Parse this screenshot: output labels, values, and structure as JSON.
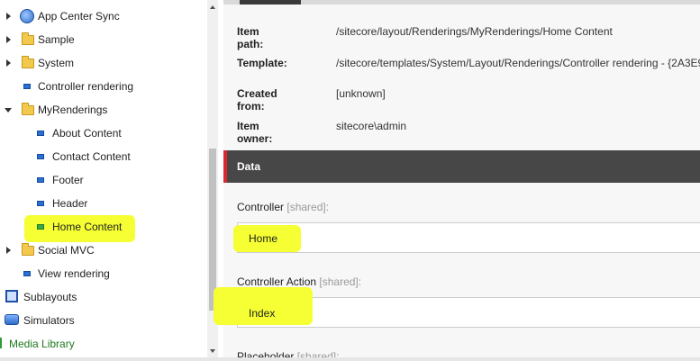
{
  "tree": {
    "items": [
      {
        "label": "App Center Sync"
      },
      {
        "label": "Sample"
      },
      {
        "label": "System"
      },
      {
        "label": "Controller rendering"
      },
      {
        "label": "MyRenderings"
      },
      {
        "label": "About Content"
      },
      {
        "label": "Contact Content"
      },
      {
        "label": "Footer"
      },
      {
        "label": "Header"
      },
      {
        "label": "Home Content"
      },
      {
        "label": "Social MVC"
      },
      {
        "label": "View rendering"
      },
      {
        "label": "Sublayouts"
      },
      {
        "label": "Simulators"
      },
      {
        "label": "Media Library"
      }
    ]
  },
  "info": {
    "item_path_label": "Item path:",
    "item_path": "/sitecore/layout/Renderings/MyRenderings/Home Content",
    "template_label": "Template:",
    "template": "/sitecore/templates/System/Layout/Renderings/Controller rendering - {2A3E9",
    "created_from_label": "Created from:",
    "created_from": "[unknown]",
    "item_owner_label": "Item owner:",
    "item_owner": "sitecore\\admin"
  },
  "data_section": {
    "title": "Data",
    "controller_label": "Controller",
    "controller_shared": "[shared]:",
    "controller_value": "Home",
    "action_label": "Controller Action",
    "action_shared": "[shared]:",
    "action_value": "Index",
    "placeholder_label": "Placeholder",
    "placeholder_shared": "[shared]:"
  },
  "colors": {
    "highlight": "#f5ff33",
    "section_header": "#474747",
    "section_accent": "#d9272e",
    "media_library_text": "#1f7a1f"
  }
}
